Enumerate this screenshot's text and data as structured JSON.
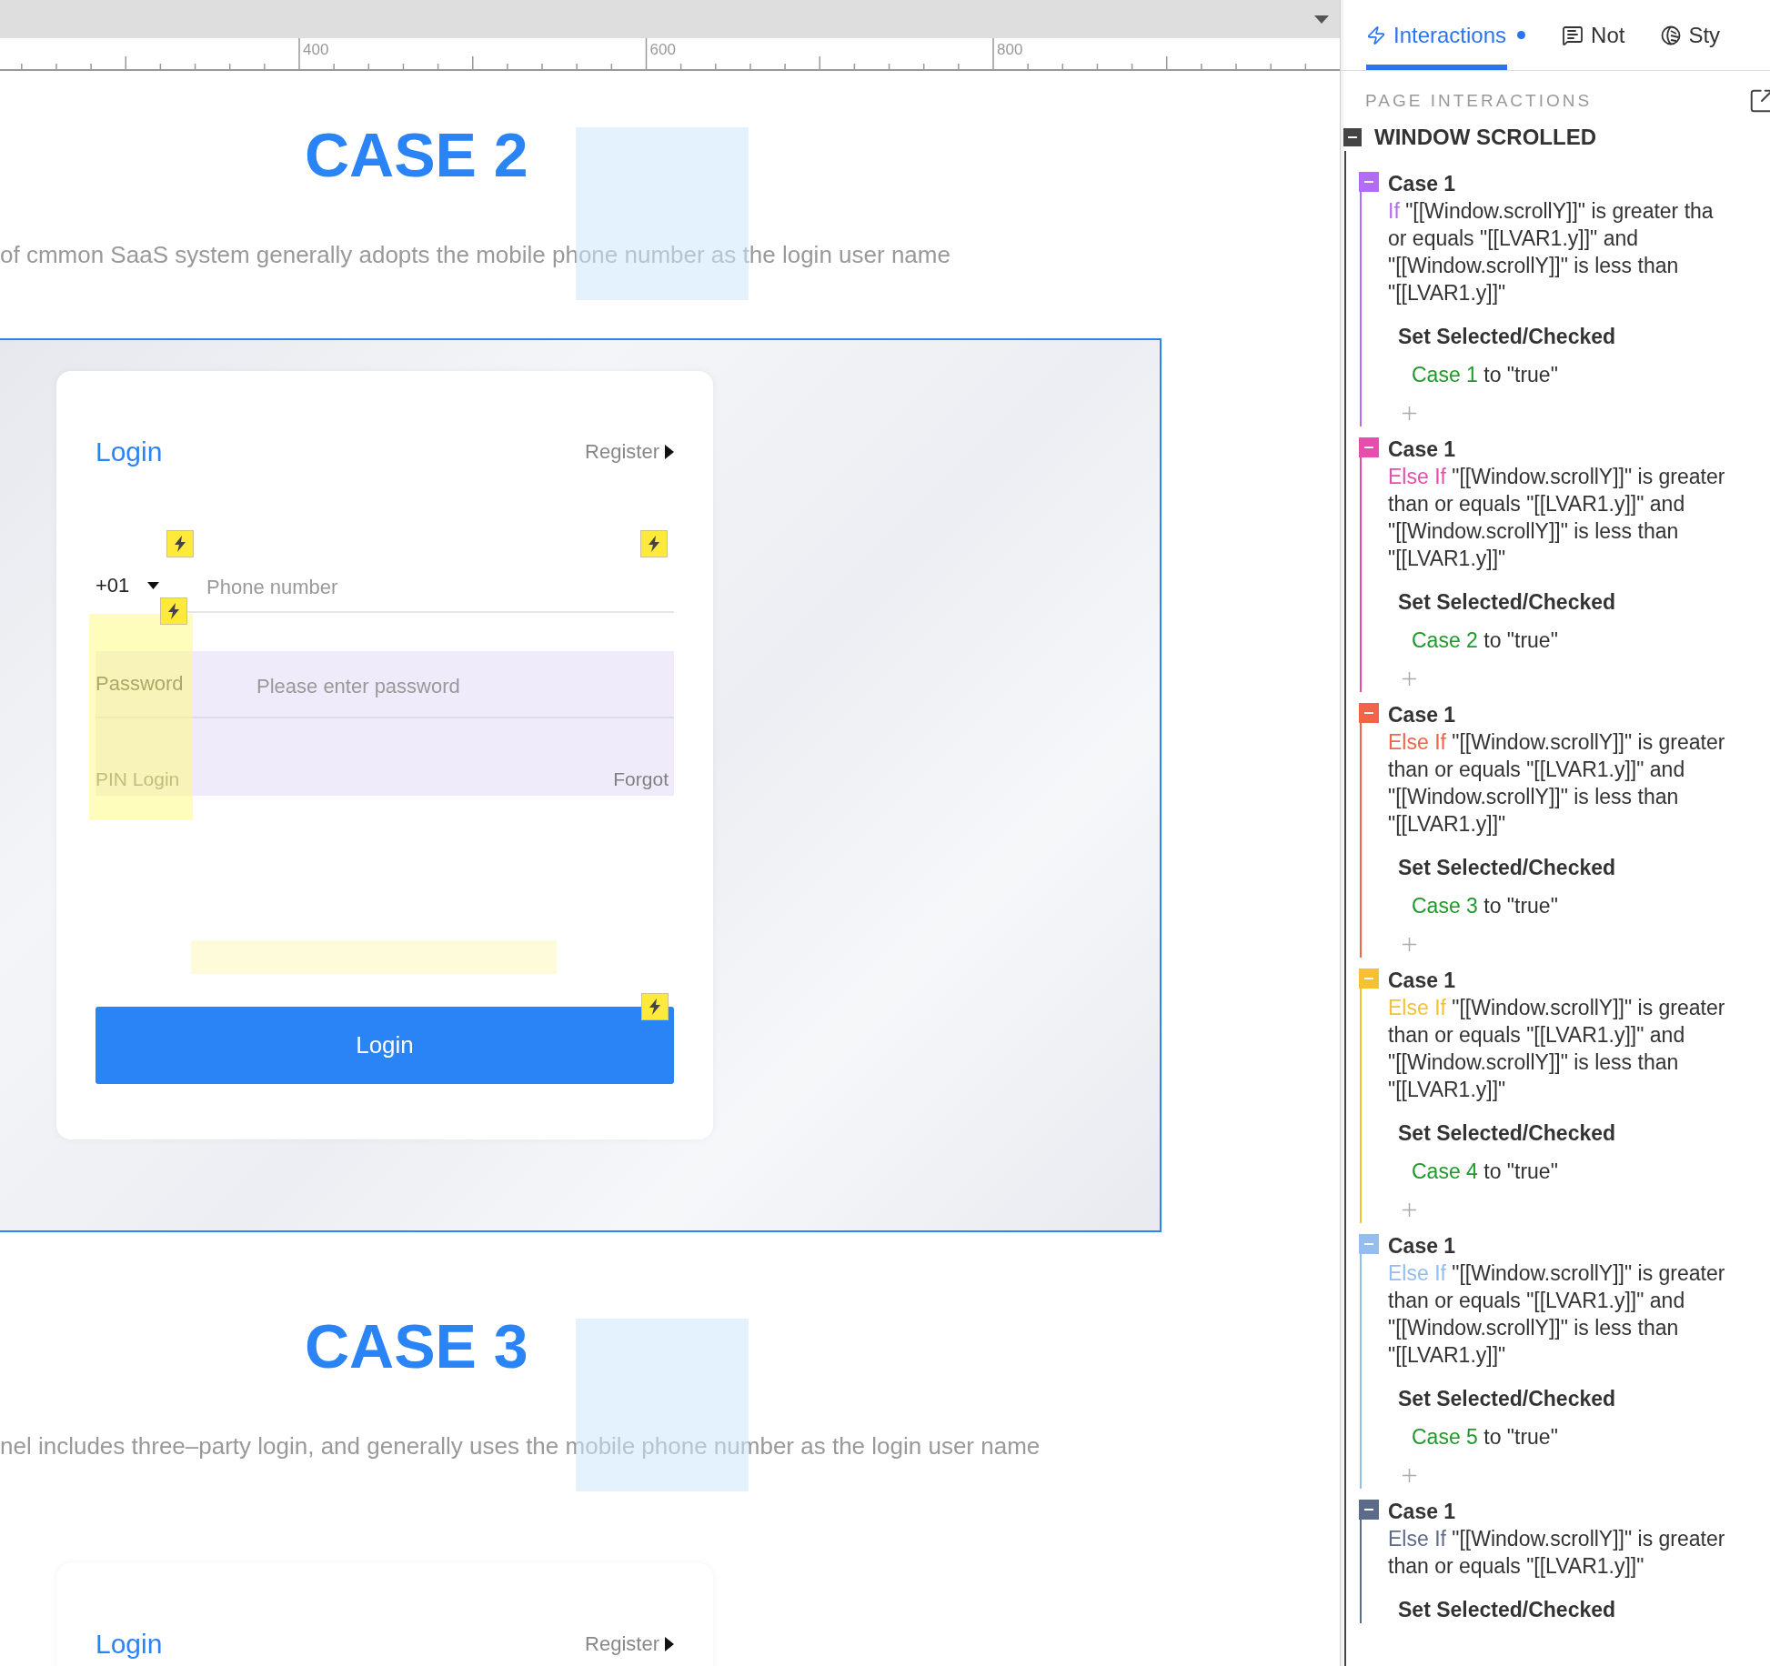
{
  "ruler": {
    "labels": [
      "400",
      "600",
      "800"
    ]
  },
  "sections": [
    {
      "heading": "CASE 2",
      "description": "of cmmon SaaS system generally adopts the mobile phone number as the login user name",
      "framed": true,
      "card": {
        "title": "Login",
        "register": "Register",
        "country_code": "+01",
        "phone_placeholder": "Phone number",
        "password_label": "Password",
        "password_placeholder": "Please enter password",
        "pin_login": "PIN Login",
        "forgot": "Forgot",
        "button": "Login"
      }
    },
    {
      "heading": "CASE 3",
      "description": "nel includes three–party login, and generally uses the mobile phone number as the login user name",
      "framed": false,
      "card": {
        "title": "Login",
        "register": "Register"
      }
    }
  ],
  "panel": {
    "tabs": [
      {
        "kind": "interactions",
        "label": "Interactions",
        "selected": true,
        "dot": true
      },
      {
        "kind": "notes",
        "label": "Not",
        "selected": false,
        "dot": false
      },
      {
        "kind": "style",
        "label": "Sty",
        "selected": false,
        "dot": false
      }
    ],
    "section_title": "PAGE INTERACTIONS",
    "event": {
      "title": "WINDOW SCROLLED",
      "expanded": true,
      "cases": [
        {
          "title": "Case 1",
          "color": "#b36cf5",
          "expanded": true,
          "keyword": "If",
          "lines": [
            "\"[[Window.scrollY]]\" is greater tha",
            "or equals \"[[LVAR1.y]]\" and",
            "\"[[Window.scrollY]]\" is less than",
            "\"[[LVAR1.y]]\""
          ],
          "action": "Set Selected/Checked",
          "target": "Case 1",
          "target_suffix": "to \"true\""
        },
        {
          "title": "Case 1",
          "color": "#e84cad",
          "expanded": true,
          "keyword": "Else If",
          "lines": [
            "\"[[Window.scrollY]]\" is greater",
            "than or equals \"[[LVAR1.y]]\" and",
            "\"[[Window.scrollY]]\" is less than",
            "\"[[LVAR1.y]]\""
          ],
          "action": "Set Selected/Checked",
          "target": "Case 2",
          "target_suffix": "to \"true\""
        },
        {
          "title": "Case 1",
          "color": "#f2644a",
          "expanded": true,
          "keyword": "Else If",
          "lines": [
            "\"[[Window.scrollY]]\" is greater",
            "than or equals \"[[LVAR1.y]]\" and",
            "\"[[Window.scrollY]]\" is less than",
            "\"[[LVAR1.y]]\""
          ],
          "action": "Set Selected/Checked",
          "target": "Case 3",
          "target_suffix": "to \"true\""
        },
        {
          "title": "Case 1",
          "color": "#f5c132",
          "expanded": true,
          "keyword": "Else If",
          "lines": [
            "\"[[Window.scrollY]]\" is greater",
            "than or equals \"[[LVAR1.y]]\" and",
            "\"[[Window.scrollY]]\" is less than",
            "\"[[LVAR1.y]]\""
          ],
          "action": "Set Selected/Checked",
          "target": "Case 4",
          "target_suffix": "to \"true\""
        },
        {
          "title": "Case 1",
          "color": "#94bdf0",
          "expanded": true,
          "keyword": "Else If",
          "lines": [
            "\"[[Window.scrollY]]\" is greater",
            "than or equals \"[[LVAR1.y]]\" and",
            "\"[[Window.scrollY]]\" is less than",
            "\"[[LVAR1.y]]\""
          ],
          "action": "Set Selected/Checked",
          "target": "Case 5",
          "target_suffix": "to \"true\""
        },
        {
          "title": "Case 1",
          "color": "#5d6b8a",
          "expanded": true,
          "keyword": "Else If",
          "lines": [
            "\"[[Window.scrollY]]\" is greater",
            "than or equals \"[[LVAR1.y]]\""
          ],
          "action": "Set Selected/Checked"
        }
      ]
    }
  }
}
